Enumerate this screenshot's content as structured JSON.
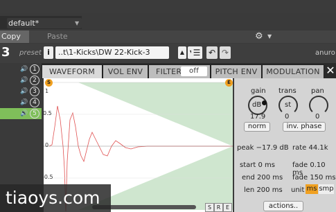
{
  "top": {
    "preset_value": "default*",
    "copy_label": "Copy",
    "paste_label": "Paste"
  },
  "header": {
    "slot_number": "3",
    "preset_label": "preset",
    "sample_path": "..t\\1-Kicks\\DW 22-Kick-3",
    "right_text": "anuro"
  },
  "tracks": [
    {
      "num": "1"
    },
    {
      "num": "2"
    },
    {
      "num": "3"
    },
    {
      "num": "4"
    },
    {
      "num": "5"
    }
  ],
  "tabs": {
    "waveform": "WAVEFORM",
    "vol_env": "VOL ENV",
    "filter": "FILTER",
    "filter_state": "off",
    "pitch_env": "PITCH ENV",
    "modulation": "MODULATION"
  },
  "wave": {
    "marker_start": "S",
    "marker_end": "E",
    "ticks": [
      "1",
      "0.5",
      "0",
      "-0.5"
    ],
    "bottom_buttons": [
      "S",
      "R",
      "E"
    ]
  },
  "params": {
    "gain_label": "gain",
    "gain_unit": "dB",
    "gain_value": "17.9",
    "trans_label": "trans",
    "trans_unit": "st",
    "trans_value": "0",
    "pan_label": "pan",
    "pan_value": "0",
    "norm_label": "norm",
    "inv_phase_label": "inv. phase",
    "peak_text": "peak −17.9 dB",
    "rate_text": "rate 44.1k",
    "start_text": "start 0 ms",
    "fade_text": "fade 0.10 ms",
    "end_text": "end 200 ms",
    "fade2_text": "fade 150 ms",
    "len_text": "len 200 ms",
    "unit_label": "unit",
    "unit_ms": "ms",
    "unit_smp": "smp",
    "actions_label": "actions.."
  },
  "watermark": "tiaoys.com",
  "colors": {
    "wave": "#f06a6a",
    "env": "#cfe6cf",
    "active_track": "#7fbf5a",
    "orange": "#f0a020"
  }
}
